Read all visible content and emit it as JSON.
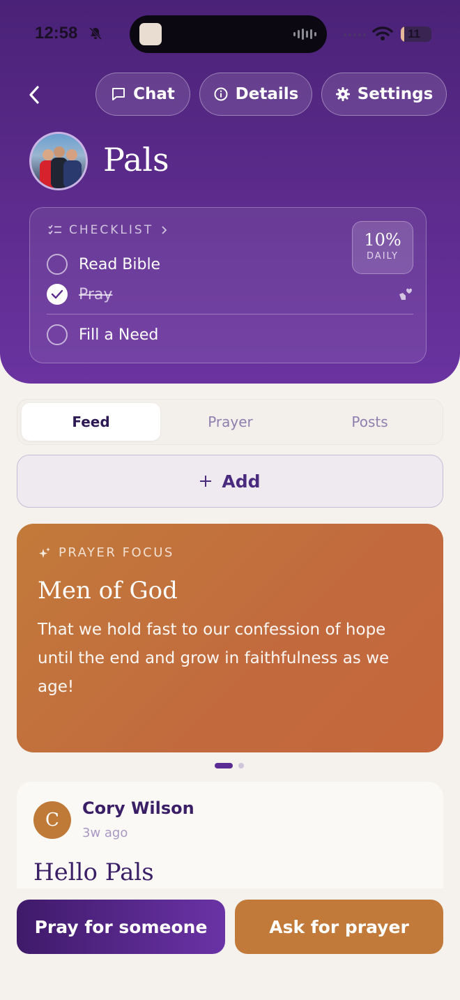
{
  "status_bar": {
    "time": "12:58",
    "battery": "11",
    "battery_level": 0.11
  },
  "nav": {
    "chat_label": "Chat",
    "details_label": "Details",
    "settings_label": "Settings"
  },
  "group": {
    "name": "Pals"
  },
  "checklist": {
    "header": "CHECKLIST",
    "percent": "10%",
    "percent_label": "DAILY",
    "items": [
      {
        "label": "Read Bible",
        "checked": false
      },
      {
        "label": "Pray",
        "checked": true
      },
      {
        "label": "Fill a Need",
        "checked": false
      }
    ]
  },
  "tabs": [
    {
      "label": "Feed",
      "active": true
    },
    {
      "label": "Prayer",
      "active": false
    },
    {
      "label": "Posts",
      "active": false
    }
  ],
  "add_button": {
    "label": "Add"
  },
  "prayer_focus": {
    "label": "PRAYER FOCUS",
    "title": "Men of God",
    "body": "That we hold fast to our confession of hope until the end and grow in faithfulness as we age!"
  },
  "post": {
    "author_initial": "C",
    "author": "Cory Wilson",
    "time": "3w ago",
    "title": "Hello Pals"
  },
  "actions": {
    "pray_label": "Pray for someone",
    "ask_label": "Ask for prayer"
  },
  "colors": {
    "primary": "#5a2a8a",
    "accent": "#c27a3a",
    "background": "#f5f2ee"
  }
}
